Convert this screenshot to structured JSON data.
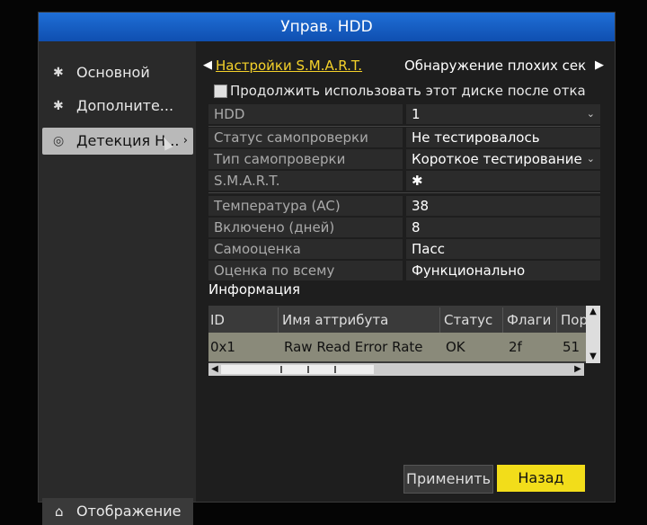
{
  "window": {
    "title": "Управ. HDD"
  },
  "sidebar": {
    "items": [
      {
        "label": "Основной",
        "icon": "gear-icon"
      },
      {
        "label": "Дополните...",
        "icon": "gear-icon"
      },
      {
        "label": "Детекция Н...",
        "icon": "disk-icon"
      }
    ],
    "footer": {
      "label": "Отображение",
      "icon": "home-icon"
    }
  },
  "tabs": {
    "active": "Настройки S.M.A.R.T.",
    "second": "Обнаружение плохих сек"
  },
  "checkbox": {
    "label": "Продолжить использовать этот диске после отка"
  },
  "fields": [
    {
      "label": "HDD",
      "value": "1"
    },
    {
      "label": "Статус самопроверки",
      "value": "Не тестировалось"
    },
    {
      "label": "Тип самопроверки",
      "value": "Короткое тестирование"
    },
    {
      "label": "S.M.A.R.T.",
      "value": ""
    }
  ],
  "stats": [
    {
      "label": "Температура (AC)",
      "value": "38"
    },
    {
      "label": "Включено (дней)",
      "value": "8"
    },
    {
      "label": "Самооценка",
      "value": "Пасс"
    },
    {
      "label": "Оценка по всему",
      "value": "Функционально"
    }
  ],
  "info": {
    "title": "Информация"
  },
  "table": {
    "headers": [
      "ID",
      "Имя аттрибута",
      "Статус",
      "Флаги",
      "Пор"
    ],
    "rows": [
      [
        "0x1",
        "Raw Read Error Rate",
        "OK",
        "2f",
        "51"
      ]
    ]
  },
  "buttons": {
    "apply": "Применить",
    "back": "Назад"
  }
}
